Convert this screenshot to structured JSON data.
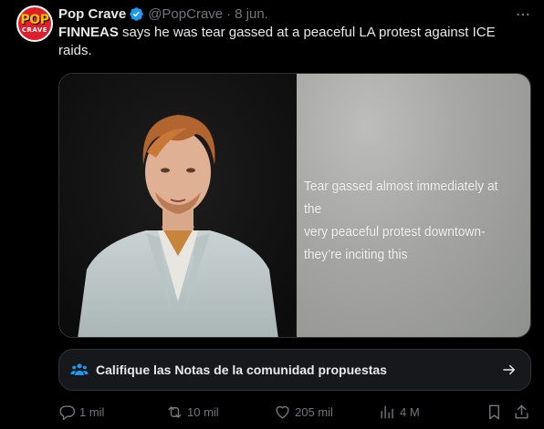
{
  "tweet": {
    "avatar_text_top": "POP",
    "avatar_text_bottom": "CRAVE",
    "author_name": "Pop Crave",
    "handle": "@PopCrave",
    "separator": "·",
    "date": "8 jun.",
    "text_bold": "FINNEAS",
    "text_rest": " says he was tear gassed at a peaceful LA protest against ICE raids.",
    "media": {
      "overlay_lines": [
        "Tear gassed almost immediately at the",
        "very peaceful protest downtown-",
        "they’re inciting this"
      ]
    },
    "community_notes": {
      "label": "Califique las Notas de la comunidad propuestas"
    },
    "actions": {
      "replies": "1 mil",
      "reposts": "10 mil",
      "likes": "205 mil",
      "views": "4 M"
    }
  },
  "colors": {
    "background": "#000000",
    "text": "#e7e9ea",
    "muted": "#71767b",
    "verified": "#1d9bf0",
    "notes_icon": "#1d9bf0",
    "border": "#2f3336"
  },
  "icons": [
    "verified-badge-icon",
    "more-options-icon",
    "community-notes-icon",
    "arrow-right-icon",
    "reply-icon",
    "repost-icon",
    "like-icon",
    "views-icon",
    "bookmark-icon",
    "share-icon"
  ]
}
